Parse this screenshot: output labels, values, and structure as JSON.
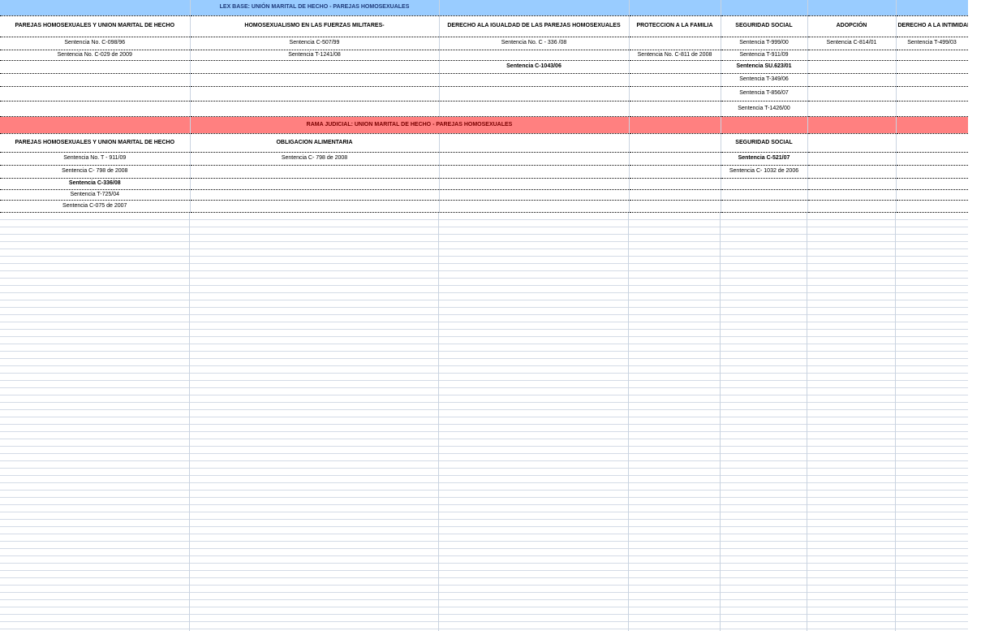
{
  "sections": {
    "lex": {
      "title": "LEX BASE: UNIÓN MARITAL DE HECHO - PAREJAS HOMOSEXUALES",
      "headers": [
        "PAREJAS HOMOSEXUALES Y UNION MARITAL DE HECHO",
        "HOMOSEXUALISMO EN LAS FUERZAS MILITARES-",
        "DERECHO ALA IGUALDAD DE LAS PAREJAS HOMOSEXUALES",
        "PROTECCION A LA FAMILIA",
        "SEGURIDAD SOCIAL",
        "ADOPCIÓN",
        "DERECHO A LA INTIMIDAD"
      ],
      "rows": [
        [
          "Sentencia No. C-098/96",
          "Sentencia C-507/99",
          "Sentencia No. C - 336 /08",
          "",
          "Sentencia T-999/00",
          "Sentencia C-814/01",
          "Sentencia T-499/03"
        ],
        [
          "Sentencia No.  C-029 de 2009",
          "Sentencia T-1241/08",
          "",
          "Sentencia No. C-811 de 2008",
          "Sentencia T-911/09",
          "",
          ""
        ],
        [
          "",
          "",
          "Sentencia C-1043/06",
          "",
          "Sentencia  SU.623/01",
          "",
          ""
        ],
        [
          "",
          "",
          "",
          "",
          "Sentencia T-349/06",
          "",
          ""
        ],
        [
          "",
          "",
          "",
          "",
          "Sentencia T-856/07",
          "",
          ""
        ],
        [
          "",
          "",
          "",
          "",
          "Sentencia T-1426/00",
          "",
          ""
        ]
      ]
    },
    "rama": {
      "title": "RAMA JUDICIAL:  UNION MARITAL DE HECHO - PAREJAS HOMOSEXUALES",
      "headers": [
        "PAREJAS HOMOSEXUALES Y UNION MARITAL DE HECHO",
        "OBLIGACION ALIMENTARIA",
        "SEGURIDAD SOCIAL"
      ],
      "rows": [
        [
          "Sentencia No. T - 911/09",
          "Sentencia C- 798 de 2008",
          "Sentencia C-521/07"
        ],
        [
          "Sentencia C- 798 de 2008",
          "",
          "Sentencia C- 1032 de 2006"
        ],
        [
          "Sentencia C-336/08",
          "",
          ""
        ],
        [
          "Sentencia T-725/04",
          "",
          ""
        ],
        [
          "Sentencia C-075 de 2007",
          "",
          ""
        ]
      ]
    }
  },
  "colors": {
    "lex_band": "#99ccff",
    "rama_band": "#ff8080",
    "grid": "#c9d3e0"
  }
}
